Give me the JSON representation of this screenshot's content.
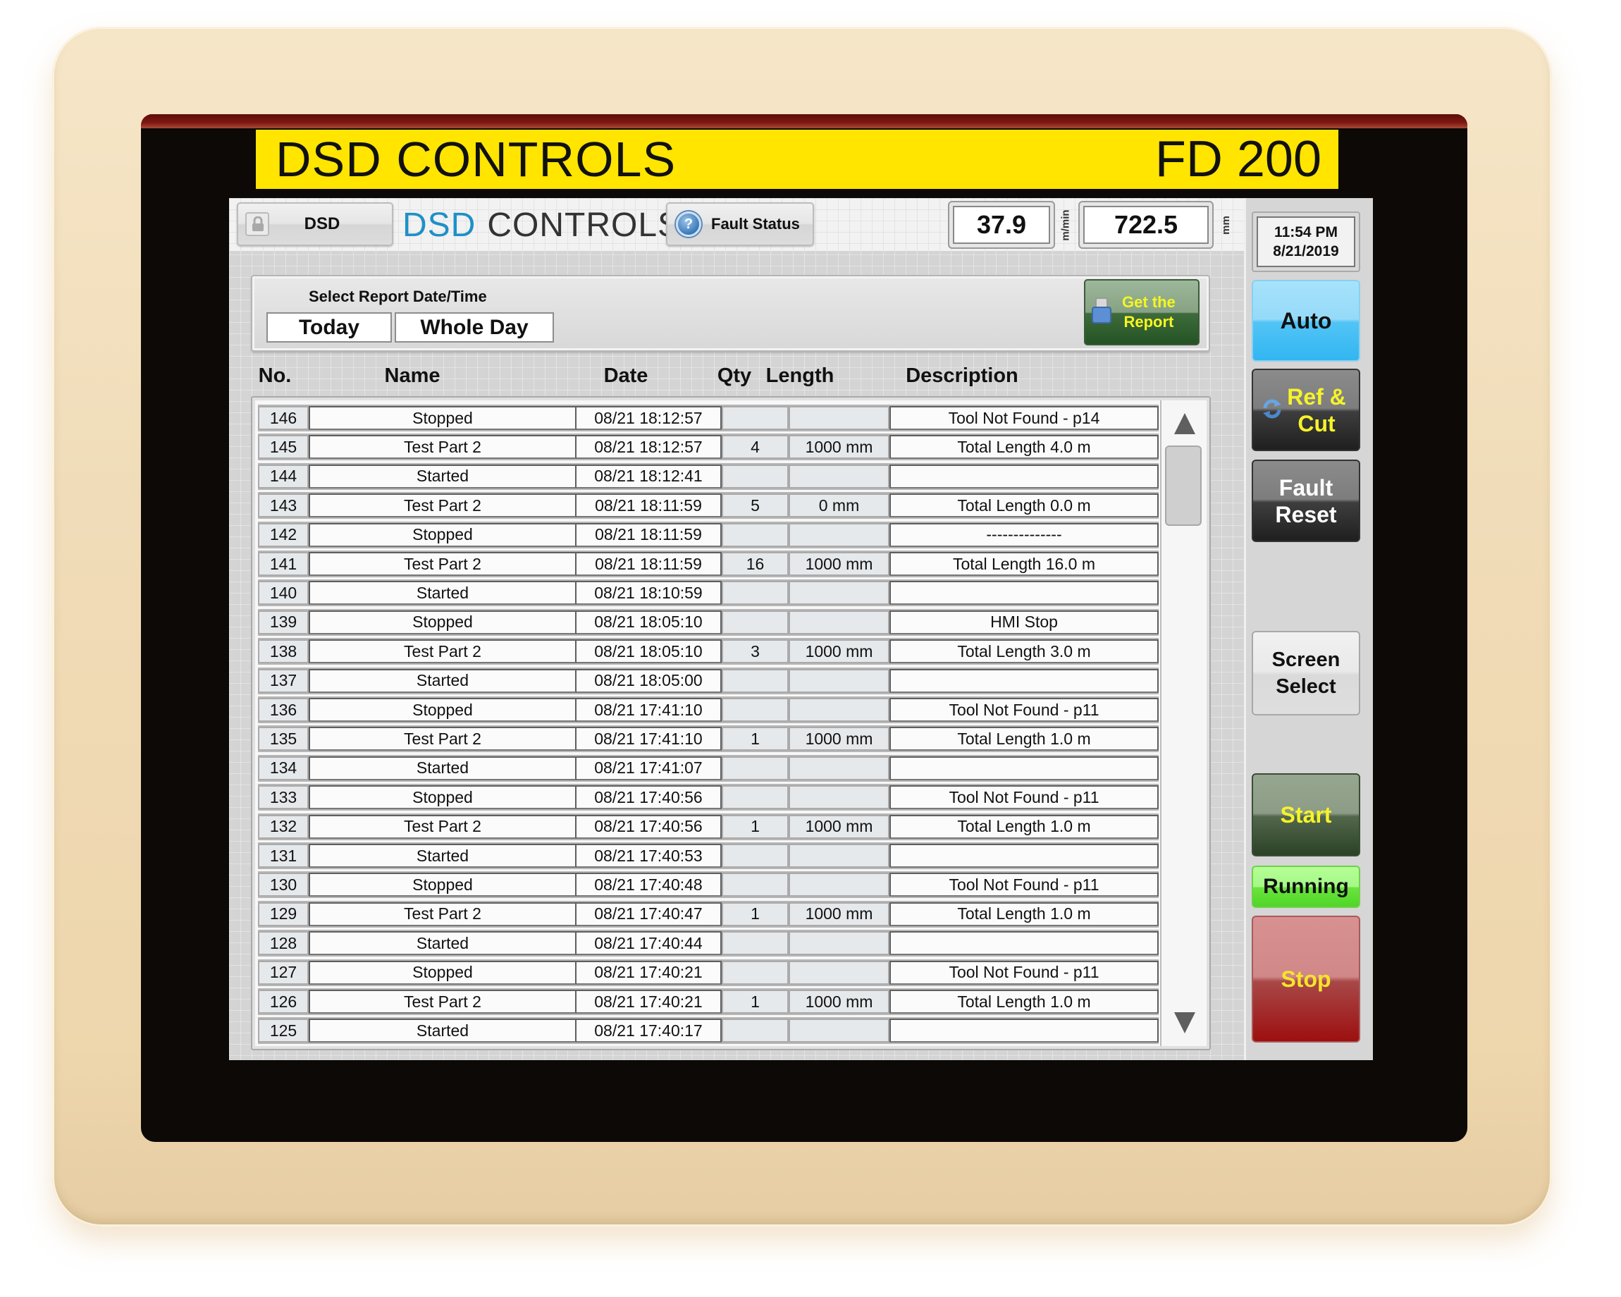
{
  "device": {
    "brand_label": "DSD CONTROLS",
    "model_label": "FD 200"
  },
  "topbar": {
    "user_button": "DSD",
    "logo_dsd": "DSD",
    "logo_controls": "CONTROLS",
    "fault_status_button": "Fault Status",
    "speed_value": "37.9",
    "speed_unit": "m/min",
    "length_value": "722.5",
    "length_unit": "mm"
  },
  "filter": {
    "title": "Select Report Date/Time",
    "date_selection": "Today",
    "range_selection": "Whole Day",
    "get_report_line1": "Get the",
    "get_report_line2": "Report"
  },
  "table": {
    "columns": [
      "No.",
      "Name",
      "Date",
      "Qty",
      "Length",
      "Description"
    ],
    "rows": [
      {
        "no": "146",
        "name": "Stopped",
        "date": "08/21 18:12:57",
        "qty": "",
        "length": "",
        "description": "Tool Not Found - p14"
      },
      {
        "no": "145",
        "name": "Test Part 2",
        "date": "08/21 18:12:57",
        "qty": "4",
        "length": "1000 mm",
        "description": "Total Length 4.0 m"
      },
      {
        "no": "144",
        "name": "Started",
        "date": "08/21 18:12:41",
        "qty": "",
        "length": "",
        "description": ""
      },
      {
        "no": "143",
        "name": "Test Part 2",
        "date": "08/21 18:11:59",
        "qty": "5",
        "length": "0 mm",
        "description": "Total Length 0.0 m"
      },
      {
        "no": "142",
        "name": "Stopped",
        "date": "08/21 18:11:59",
        "qty": "",
        "length": "",
        "description": "--------------"
      },
      {
        "no": "141",
        "name": "Test Part 2",
        "date": "08/21 18:11:59",
        "qty": "16",
        "length": "1000 mm",
        "description": "Total Length 16.0 m"
      },
      {
        "no": "140",
        "name": "Started",
        "date": "08/21 18:10:59",
        "qty": "",
        "length": "",
        "description": ""
      },
      {
        "no": "139",
        "name": "Stopped",
        "date": "08/21 18:05:10",
        "qty": "",
        "length": "",
        "description": "HMI Stop"
      },
      {
        "no": "138",
        "name": "Test Part 2",
        "date": "08/21 18:05:10",
        "qty": "3",
        "length": "1000 mm",
        "description": "Total Length 3.0 m"
      },
      {
        "no": "137",
        "name": "Started",
        "date": "08/21 18:05:00",
        "qty": "",
        "length": "",
        "description": ""
      },
      {
        "no": "136",
        "name": "Stopped",
        "date": "08/21 17:41:10",
        "qty": "",
        "length": "",
        "description": "Tool Not Found - p11"
      },
      {
        "no": "135",
        "name": "Test Part 2",
        "date": "08/21 17:41:10",
        "qty": "1",
        "length": "1000 mm",
        "description": "Total Length 1.0 m"
      },
      {
        "no": "134",
        "name": "Started",
        "date": "08/21 17:41:07",
        "qty": "",
        "length": "",
        "description": ""
      },
      {
        "no": "133",
        "name": "Stopped",
        "date": "08/21 17:40:56",
        "qty": "",
        "length": "",
        "description": "Tool Not Found - p11"
      },
      {
        "no": "132",
        "name": "Test Part 2",
        "date": "08/21 17:40:56",
        "qty": "1",
        "length": "1000 mm",
        "description": "Total Length 1.0 m"
      },
      {
        "no": "131",
        "name": "Started",
        "date": "08/21 17:40:53",
        "qty": "",
        "length": "",
        "description": ""
      },
      {
        "no": "130",
        "name": "Stopped",
        "date": "08/21 17:40:48",
        "qty": "",
        "length": "",
        "description": "Tool Not Found - p11"
      },
      {
        "no": "129",
        "name": "Test Part 2",
        "date": "08/21 17:40:47",
        "qty": "1",
        "length": "1000 mm",
        "description": "Total Length 1.0 m"
      },
      {
        "no": "128",
        "name": "Started",
        "date": "08/21 17:40:44",
        "qty": "",
        "length": "",
        "description": ""
      },
      {
        "no": "127",
        "name": "Stopped",
        "date": "08/21 17:40:21",
        "qty": "",
        "length": "",
        "description": "Tool Not Found - p11"
      },
      {
        "no": "126",
        "name": "Test Part 2",
        "date": "08/21 17:40:21",
        "qty": "1",
        "length": "1000 mm",
        "description": "Total Length 1.0 m"
      },
      {
        "no": "125",
        "name": "Started",
        "date": "08/21 17:40:17",
        "qty": "",
        "length": "",
        "description": ""
      }
    ]
  },
  "sidebar": {
    "clock_time": "11:54 PM",
    "clock_date": "8/21/2019",
    "auto_button": "Auto",
    "ref_cut_line1": "Ref &",
    "ref_cut_line2": "Cut",
    "fault_reset_line1": "Fault",
    "fault_reset_line2": "Reset",
    "screen_select_line1": "Screen",
    "screen_select_line2": "Select",
    "start_button": "Start",
    "status": "Running",
    "stop_button": "Stop"
  },
  "colors": {
    "brand_yellow": "#ffe500",
    "logo_blue": "#1e90c8",
    "auto_blue": "#52c4f6",
    "start_green": "#52674c",
    "running_green": "#6be43d",
    "stop_red": "#a84848",
    "button_text_yellow": "#f6f32a"
  }
}
